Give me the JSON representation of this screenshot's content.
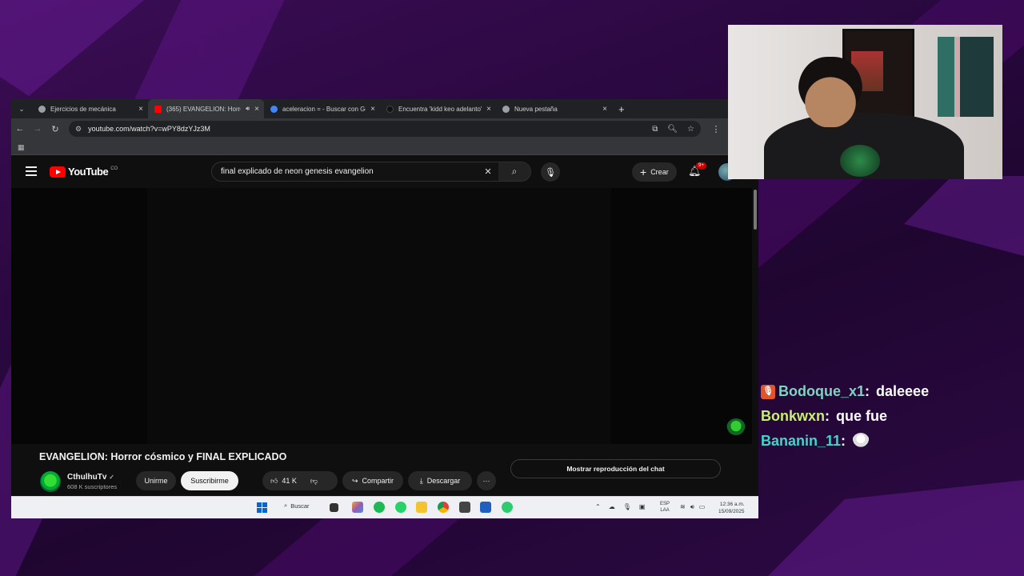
{
  "browser": {
    "tabs": [
      {
        "title": "Ejercicios de mecánica",
        "fav_color": "#9aa0a6",
        "active": false
      },
      {
        "title": "(365) EVANGELION: Horror",
        "fav_color": "#ff0000",
        "active": true
      },
      {
        "title": "aceleracion = - Buscar con Goo",
        "fav_color": "#4285f4",
        "active": false
      },
      {
        "title": "Encuentra 'kidd keo adelanto' e",
        "fav_color": "#111111",
        "active": false
      },
      {
        "title": "Nueva pestaña",
        "fav_color": "#9aa0a6",
        "active": false
      }
    ],
    "url": "youtube.com/watch?v=wPY8dzYJz3M"
  },
  "youtube": {
    "logo_text": "YouTube",
    "logo_country": "CO",
    "search_query": "final explicado de neon genesis evangelion",
    "create_label": "Crear",
    "notification_count": "9+",
    "video_title": "EVANGELION: Horror cósmico y FINAL EXPLICADO",
    "channel_name": "CthulhuTv",
    "channel_subs": "608 K suscriptores",
    "join_label": "Unirme",
    "subscribe_label": "Suscribirme",
    "likes": "41 K",
    "share_label": "Compartir",
    "download_label": "Descargar",
    "chat_replay_label": "Mostrar reproducción del chat"
  },
  "taskbar": {
    "search_label": "Buscar",
    "lang_top": "ESP",
    "lang_bottom": "LAA",
    "time": "12:36 a.m.",
    "date": "15/09/2025"
  },
  "chat": [
    {
      "user": "Bodoque_x1",
      "user_color": "#7fd4c1",
      "message": "daleeee",
      "badge": true
    },
    {
      "user": "Bonkwxn",
      "user_color": "#c7f06b",
      "message": "que fue",
      "badge": false
    },
    {
      "user": "Bananin_11",
      "user_color": "#3fd6c8",
      "message": "",
      "emote": true
    }
  ]
}
